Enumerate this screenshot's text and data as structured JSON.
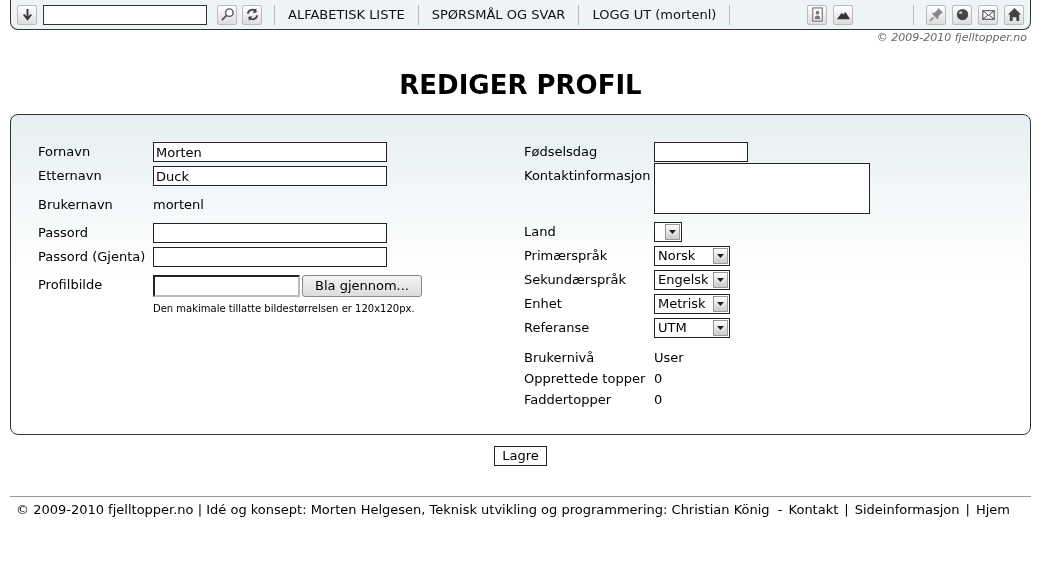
{
  "toolbar": {
    "nav_links": [
      "ALFABETISK LISTE",
      "SPØRSMÅL OG SVAR",
      "LOGG UT (mortenl)"
    ],
    "copyright": "© 2009-2010 fjelltopper.no"
  },
  "title": "REDIGER PROFIL",
  "left_fields": [
    {
      "kind": "input",
      "label": "Fornavn",
      "value": "Morten"
    },
    {
      "kind": "input",
      "label": "Etternavn",
      "value": "Duck"
    },
    {
      "kind": "text",
      "label": "Brukernavn",
      "value": "mortenl"
    },
    {
      "kind": "input",
      "label": "Passord"
    },
    {
      "kind": "input",
      "label": "Passord (Gjenta)"
    },
    {
      "kind": "file",
      "label": "Profilbilde",
      "button": "Bla gjennom...",
      "hint": "Den makimale tillatte bildestørrelsen er 120x120px."
    }
  ],
  "right_fields": [
    {
      "kind": "date",
      "label": "Fødselsdag"
    },
    {
      "kind": "textarea",
      "label": "Kontaktinformasjon"
    },
    {
      "kind": "select",
      "label": "Land"
    },
    {
      "kind": "select",
      "label": "Primærspråk",
      "value": "Norsk"
    },
    {
      "kind": "select",
      "label": "Sekundærspråk",
      "value": "Engelsk"
    },
    {
      "kind": "select",
      "label": "Enhet",
      "value": "Metrisk"
    },
    {
      "kind": "select",
      "label": "Referanse",
      "value": "UTM"
    },
    {
      "kind": "text",
      "label": "Brukernivå",
      "value": "User"
    },
    {
      "kind": "text",
      "label": "Opprettede topper",
      "value": "0"
    },
    {
      "kind": "text",
      "label": "Faddertopper",
      "value": "0"
    }
  ],
  "save_button": "Lagre",
  "footer": [
    {
      "kind": "text",
      "text": "© 2009-2010 fjelltopper.no | Idé og konsept: Morten Helgesen, Teknisk utvikling og programmering: Christian König  -"
    },
    {
      "kind": "link",
      "text": "Kontakt"
    },
    {
      "kind": "text",
      "text": "|"
    },
    {
      "kind": "link",
      "text": "Sideinformasjon"
    },
    {
      "kind": "text",
      "text": "|"
    },
    {
      "kind": "link",
      "text": "Hjem"
    }
  ]
}
